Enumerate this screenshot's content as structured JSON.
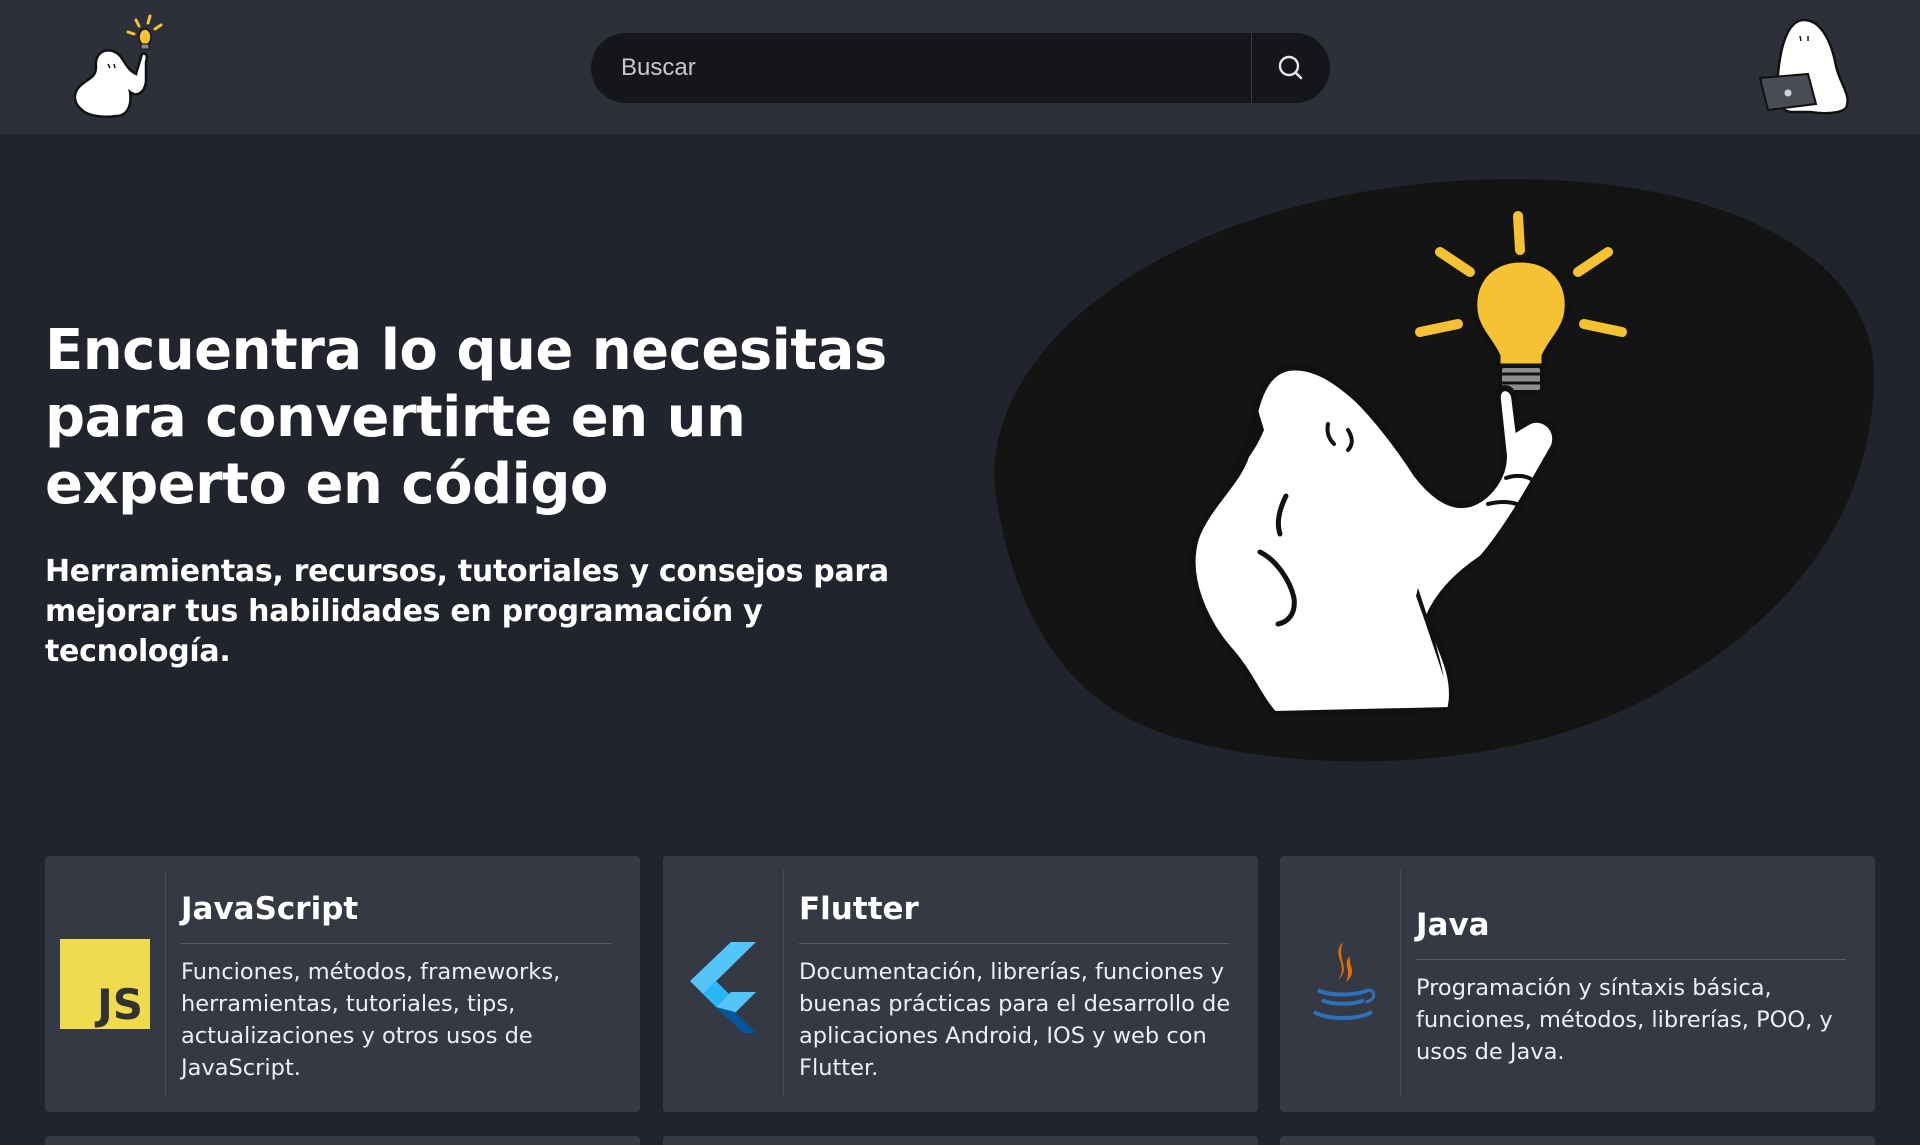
{
  "header": {
    "logo_icon": "ghost-lightbulb-logo-icon",
    "search": {
      "placeholder": "Buscar",
      "icon": "search-icon"
    },
    "profile_icon": "ghost-laptop-icon"
  },
  "hero": {
    "title": "Encuentra lo que necesitas para convertirte en un experto en código",
    "subtitle": "Herramientas, recursos, tutoriales y consejos para mejorar tus habilidades en programación y tecnología.",
    "illustration": "ghost-idea-illustration"
  },
  "cards": [
    {
      "title": "JavaScript",
      "description": "Funciones, métodos, frameworks, herramientas, tutoriales, tips, actualizaciones y otros usos de JavaScript.",
      "icon": "javascript-icon",
      "icon_text": "JS"
    },
    {
      "title": "Flutter",
      "description": "Documentación, librerías, funciones y buenas prácticas para el desarrollo de aplicaciones Android, IOS y web con Flutter.",
      "icon": "flutter-icon"
    },
    {
      "title": "Java",
      "description": "Programación y síntaxis básica, funciones, métodos, librerías, POO, y usos de Java.",
      "icon": "java-icon"
    }
  ],
  "colors": {
    "page_bg": "#21242c",
    "header_bg": "#2d3039",
    "card_bg": "#353944",
    "search_bg": "#151619",
    "accent_yellow": "#f6c132",
    "js_yellow": "#f0db4f",
    "flutter_blue": "#44b7f2",
    "java_orange": "#e76f00",
    "java_blue": "#2d72b8"
  }
}
